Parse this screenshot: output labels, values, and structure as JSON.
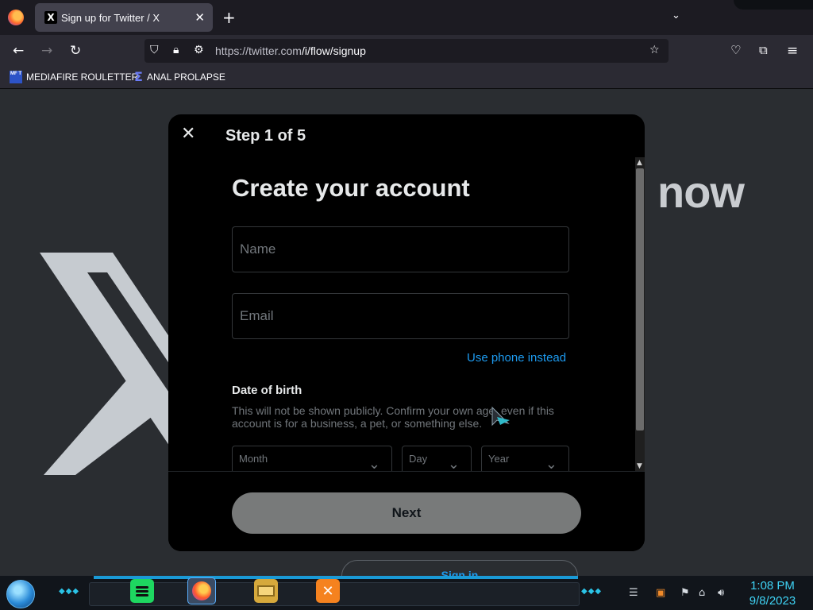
{
  "browser": {
    "tab_title": "Sign up for Twitter / X",
    "tab_favicon": "X",
    "new_tab_symbol": "+",
    "tab_close_symbol": "✕",
    "tab_list_symbol": "⌄",
    "url_domain": "https://twitter.com",
    "url_path": "/i/flow/signup",
    "bookmarks": [
      {
        "label": "MEDIAFIRE ROULETTER",
        "icon": "MF T"
      },
      {
        "label": "ANAL PROLAPSE",
        "icon": "sigma-icon"
      }
    ]
  },
  "background": {
    "partial_heading": "now",
    "signin_partial": "Sign in"
  },
  "modal": {
    "close_symbol": "✕",
    "step": "Step 1 of 5",
    "title": "Create your account",
    "name_placeholder": "Name",
    "email_placeholder": "Email",
    "use_phone": "Use phone instead",
    "dob_title": "Date of birth",
    "dob_desc": "This will not be shown publicly. Confirm your own age, even if this account is for a business, a pet, or something else.",
    "month_label": "Month",
    "day_label": "Day",
    "year_label": "Year",
    "next_button": "Next"
  },
  "taskbar": {
    "time": "1:08 PM",
    "date": "9/8/2023",
    "apps": [
      "spotify-icon",
      "firefox-icon",
      "file-explorer-icon",
      "xampp-icon"
    ]
  },
  "colors": {
    "accent": "#1d9bf0",
    "modal_bg": "#000000",
    "page_bg": "#2a2d31",
    "next_button_bg": "#787a7a",
    "clock": "#3fd3f5"
  }
}
